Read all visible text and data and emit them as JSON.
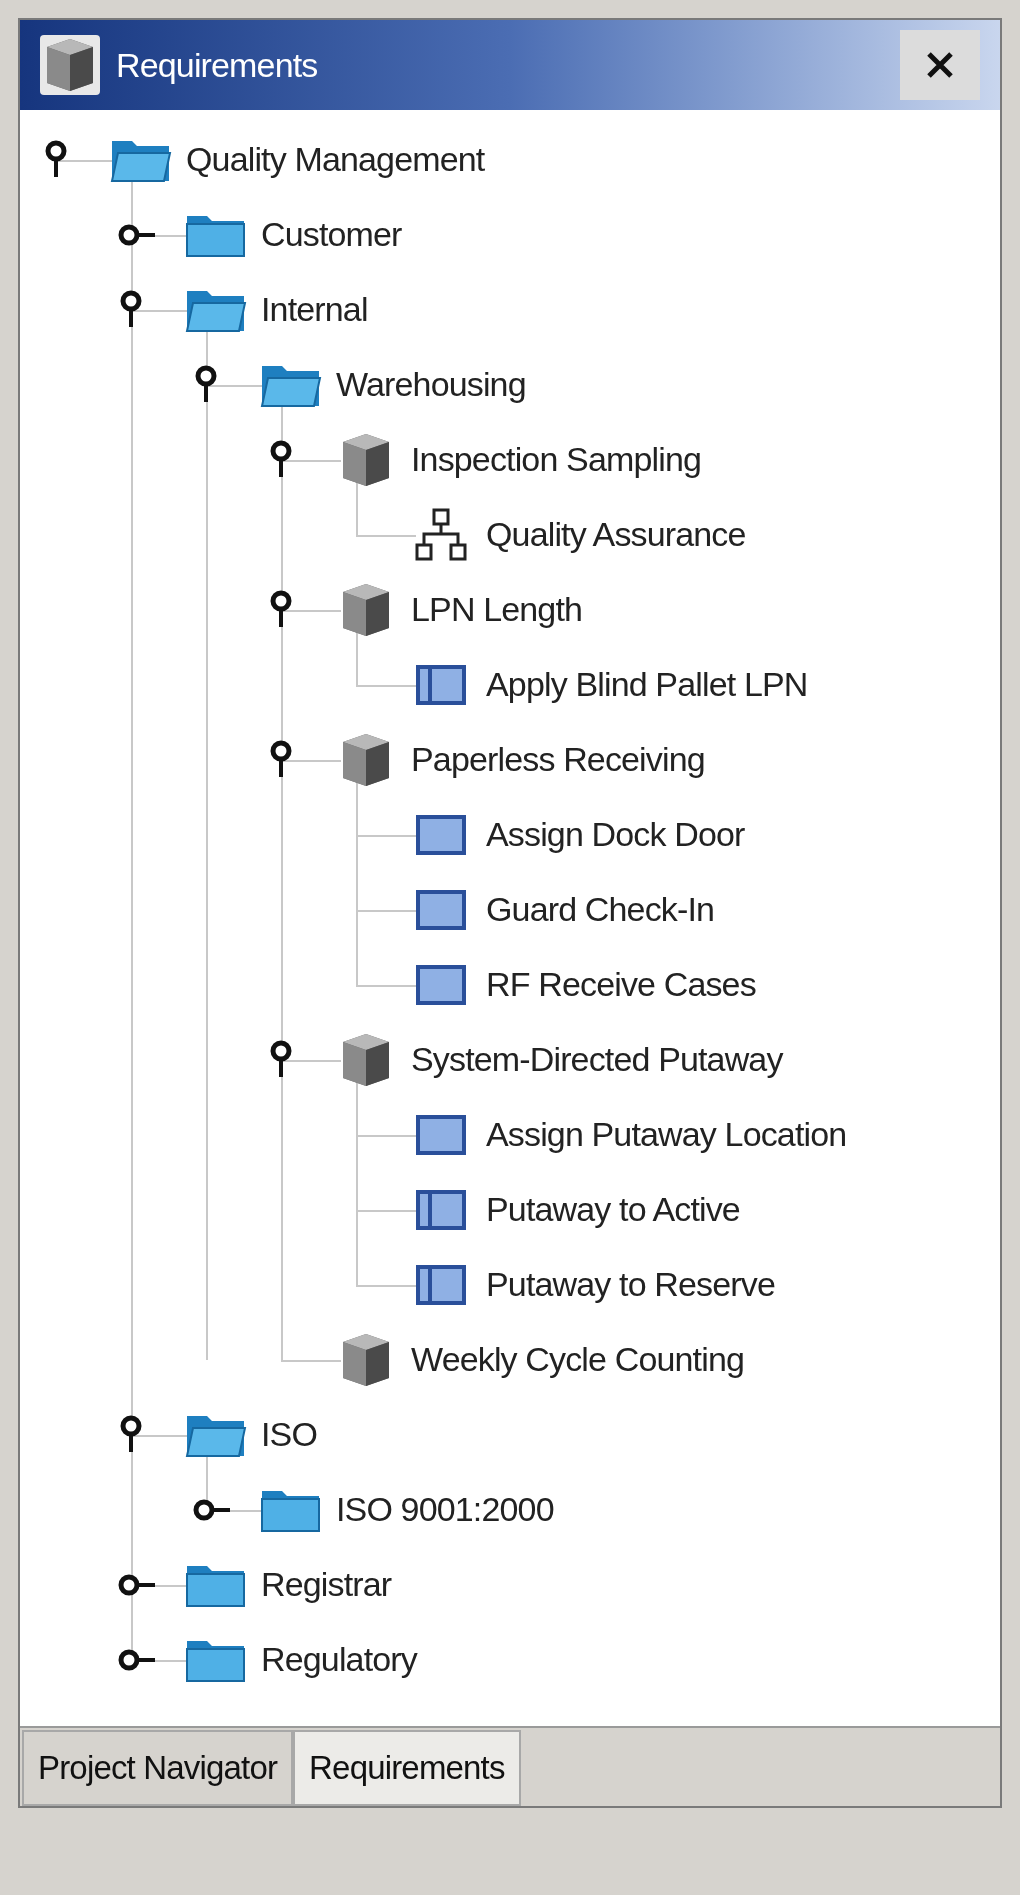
{
  "window": {
    "title": "Requirements"
  },
  "tree": [
    {
      "label": "Quality Management",
      "kind": "folder",
      "expanded": true,
      "children": [
        {
          "label": "Customer",
          "kind": "folder",
          "expanded": false
        },
        {
          "label": "Internal",
          "kind": "folder",
          "expanded": true,
          "children": [
            {
              "label": "Warehousing",
              "kind": "folder",
              "expanded": true,
              "children": [
                {
                  "label": "Inspection Sampling",
                  "kind": "cube",
                  "expanded": true,
                  "children": [
                    {
                      "label": "Quality Assurance",
                      "kind": "network"
                    }
                  ]
                },
                {
                  "label": "LPN Length",
                  "kind": "cube",
                  "expanded": true,
                  "children": [
                    {
                      "label": "Apply Blind Pallet LPN",
                      "kind": "split"
                    }
                  ]
                },
                {
                  "label": "Paperless Receiving",
                  "kind": "cube",
                  "expanded": true,
                  "children": [
                    {
                      "label": "Assign Dock Door",
                      "kind": "panel"
                    },
                    {
                      "label": "Guard Check-In",
                      "kind": "panel"
                    },
                    {
                      "label": "RF Receive Cases",
                      "kind": "panel"
                    }
                  ]
                },
                {
                  "label": "System-Directed Putaway",
                  "kind": "cube",
                  "expanded": true,
                  "children": [
                    {
                      "label": "Assign Putaway Location",
                      "kind": "panel"
                    },
                    {
                      "label": "Putaway to Active",
                      "kind": "split"
                    },
                    {
                      "label": "Putaway to Reserve",
                      "kind": "split"
                    }
                  ]
                },
                {
                  "label": "Weekly Cycle Counting",
                  "kind": "cube"
                }
              ]
            }
          ]
        },
        {
          "label": "ISO",
          "kind": "folder",
          "expanded": true,
          "children": [
            {
              "label": "ISO 9001:2000",
              "kind": "folder",
              "expanded": false
            }
          ]
        },
        {
          "label": "Registrar",
          "kind": "folder",
          "expanded": false
        },
        {
          "label": "Regulatory",
          "kind": "folder",
          "expanded": false
        }
      ]
    }
  ],
  "tabs": [
    {
      "label": "Project Navigator",
      "selected": false
    },
    {
      "label": "Requirements",
      "selected": true
    }
  ]
}
